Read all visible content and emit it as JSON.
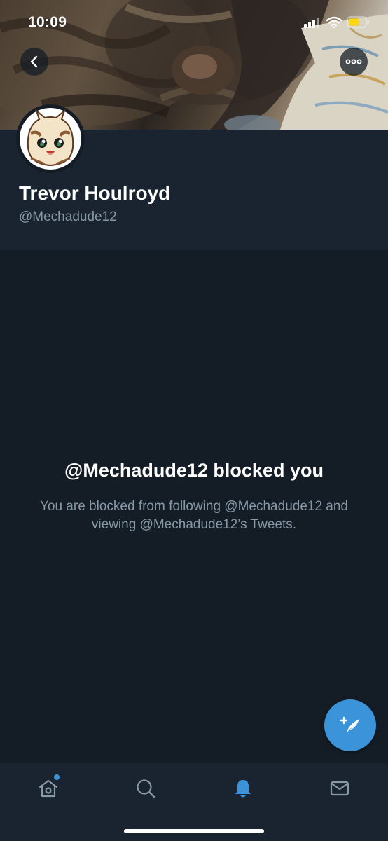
{
  "status_bar": {
    "time": "10:09"
  },
  "profile": {
    "display_name": "Trevor Houlroyd",
    "handle": "@Mechadude12"
  },
  "blocked": {
    "title": "@Mechadude12 blocked you",
    "description": "You are blocked from following @Mechadude12 and viewing @Mechadude12’s Tweets."
  },
  "tabs": [
    {
      "name": "home",
      "icon": "home-icon",
      "active": false,
      "has_notification_dot": true
    },
    {
      "name": "search",
      "icon": "search-icon",
      "active": false
    },
    {
      "name": "notifications",
      "icon": "bell-icon",
      "active": true
    },
    {
      "name": "messages",
      "icon": "mail-icon",
      "active": false
    }
  ],
  "icons": {
    "back": "chevron-left-icon",
    "more": "more-horizontal-icon",
    "compose": "compose-tweet-icon"
  },
  "colors": {
    "background": "#141d26",
    "header_background": "#192430",
    "accent": "#3b94d9",
    "secondary_text": "#8899a6",
    "primary_text": "#ffffff"
  }
}
